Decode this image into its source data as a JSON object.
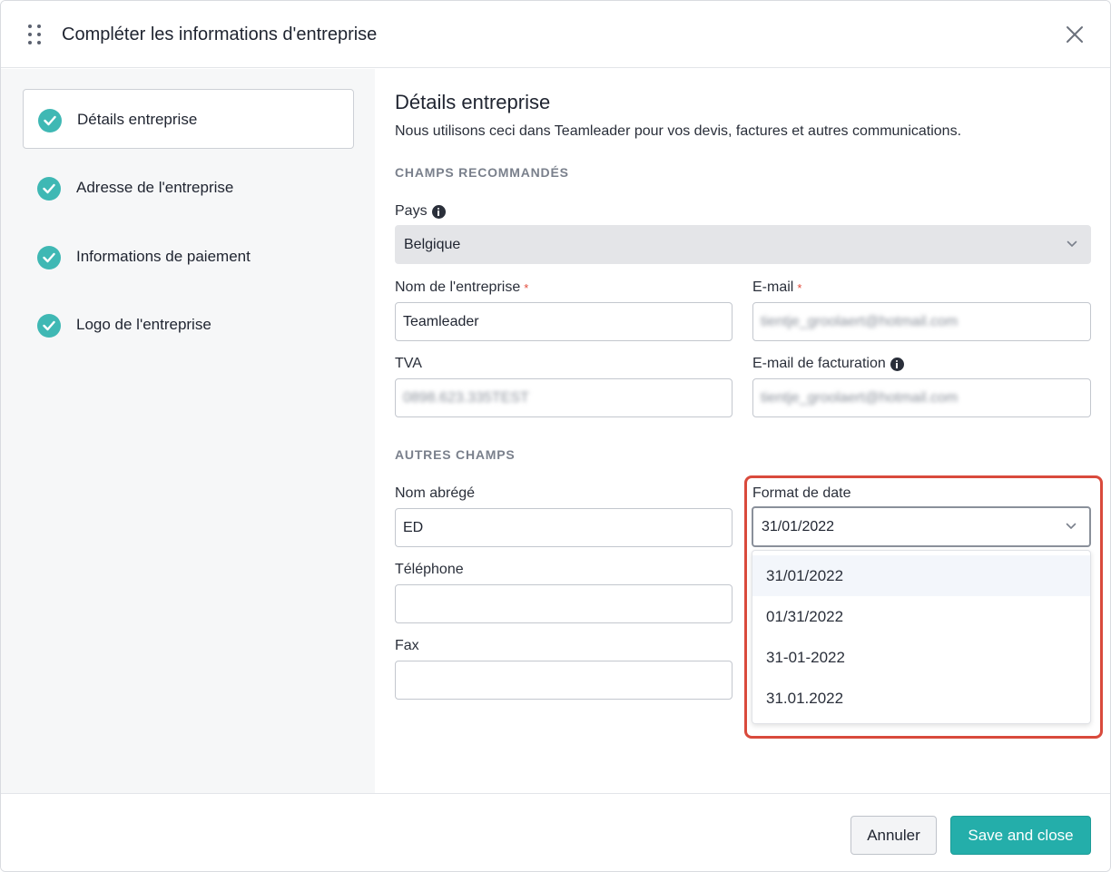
{
  "header": {
    "title": "Compléter les informations d'entreprise"
  },
  "sidebar": {
    "steps": [
      {
        "label": "Détails entreprise"
      },
      {
        "label": "Adresse de l'entreprise"
      },
      {
        "label": "Informations de paiement"
      },
      {
        "label": "Logo de l'entreprise"
      }
    ]
  },
  "content": {
    "title": "Détails entreprise",
    "description": "Nous utilisons ceci dans Teamleader pour vos devis, factures et autres communications.",
    "recommended_label": "CHAMPS RECOMMANDÉS",
    "other_label": "AUTRES CHAMPS",
    "country": {
      "label": "Pays",
      "value": "Belgique"
    },
    "company_name": {
      "label": "Nom de l'entreprise",
      "value": "Teamleader"
    },
    "email": {
      "label": "E-mail",
      "value": "tientje_groolaert@hotmail.com"
    },
    "vat": {
      "label": "TVA",
      "value": "0898.623.335TEST"
    },
    "billing_email": {
      "label": "E-mail de facturation",
      "value": "tientje_groolaert@hotmail.com"
    },
    "short_name": {
      "label": "Nom abrégé",
      "value": "ED"
    },
    "phone": {
      "label": "Téléphone",
      "value": ""
    },
    "fax": {
      "label": "Fax",
      "value": ""
    },
    "date_format": {
      "label": "Format de date",
      "value": "31/01/2022",
      "options": [
        "31/01/2022",
        "01/31/2022",
        "31-01-2022",
        "31.01.2022"
      ]
    },
    "required_mark": "*"
  },
  "footer": {
    "cancel_label": "Annuler",
    "save_label": "Save and close"
  },
  "colors": {
    "accent": "#24aeaa",
    "check": "#3fb8b4",
    "highlight": "#d94a3c",
    "required": "#e24b3b"
  },
  "icons": [
    "drag-handle-icon",
    "close-icon",
    "check-circle-icon",
    "info-icon",
    "chevron-down-icon"
  ]
}
